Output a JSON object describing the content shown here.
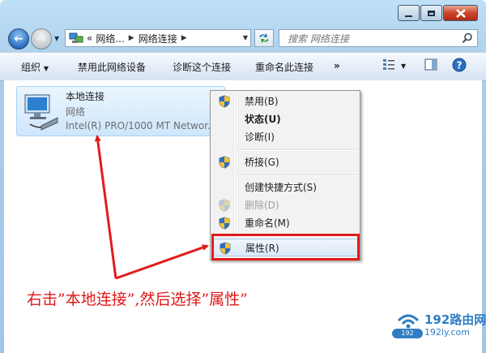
{
  "address": {
    "overflow": "«",
    "crumbs": [
      "网络...",
      "网络连接"
    ]
  },
  "search": {
    "placeholder": "搜索 网络连接"
  },
  "toolbar": {
    "organize": "组织",
    "disable": "禁用此网络设备",
    "diagnose": "诊断这个连接",
    "rename": "重命名此连接",
    "more": "»"
  },
  "connection": {
    "name": "本地连接",
    "network": "网络",
    "device": "Intel(R) PRO/1000 MT Networ..."
  },
  "context_menu": {
    "items": [
      {
        "label": "禁用(B)",
        "shield": true,
        "enabled": true,
        "bold": false
      },
      {
        "label": "状态(U)",
        "shield": false,
        "enabled": true,
        "bold": true
      },
      {
        "label": "诊断(I)",
        "shield": false,
        "enabled": true,
        "bold": false
      },
      {
        "label": "桥接(G)",
        "shield": true,
        "enabled": true,
        "bold": false
      },
      {
        "label": "创建快捷方式(S)",
        "shield": false,
        "enabled": true,
        "bold": false
      },
      {
        "label": "删除(D)",
        "shield": true,
        "enabled": false,
        "bold": false
      },
      {
        "label": "重命名(M)",
        "shield": true,
        "enabled": true,
        "bold": false
      },
      {
        "label": "属性(R)",
        "shield": true,
        "enabled": true,
        "bold": false,
        "highlighted": true
      }
    ]
  },
  "annotation": {
    "text": "右击”本地连接”,然后选择”属性”",
    "color": "#e01818"
  },
  "watermark": {
    "brand": "192路由网",
    "url": "192ly.com",
    "tag": "192"
  },
  "colors": {
    "accent": "#2f7ec3",
    "highlight_red": "#e21b1b"
  }
}
